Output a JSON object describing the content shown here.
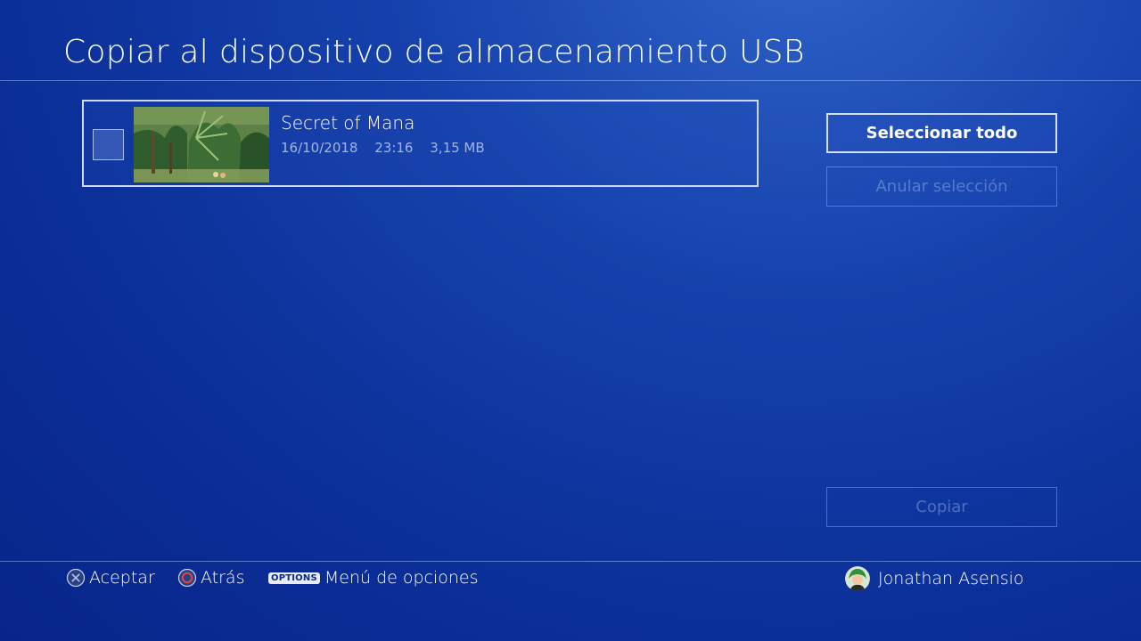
{
  "header": {
    "title": "Copiar al dispositivo de almacenamiento USB"
  },
  "items": [
    {
      "title": "Secret of Mana",
      "date": "16/10/2018",
      "time": "23:16",
      "size": "3,15 MB",
      "checked": false
    }
  ],
  "actions": {
    "select_all": "Seleccionar todo",
    "deselect": "Anular selección",
    "copy": "Copiar"
  },
  "footer": {
    "accept": "Aceptar",
    "back": "Atrás",
    "options_badge": "OPTIONS",
    "options_menu": "Menú de opciones",
    "user_name": "Jonathan Asensio"
  },
  "icons": {
    "accept": "cross-button-icon",
    "back": "circle-button-icon",
    "options": "options-button-icon",
    "avatar": "user-avatar-icon"
  }
}
